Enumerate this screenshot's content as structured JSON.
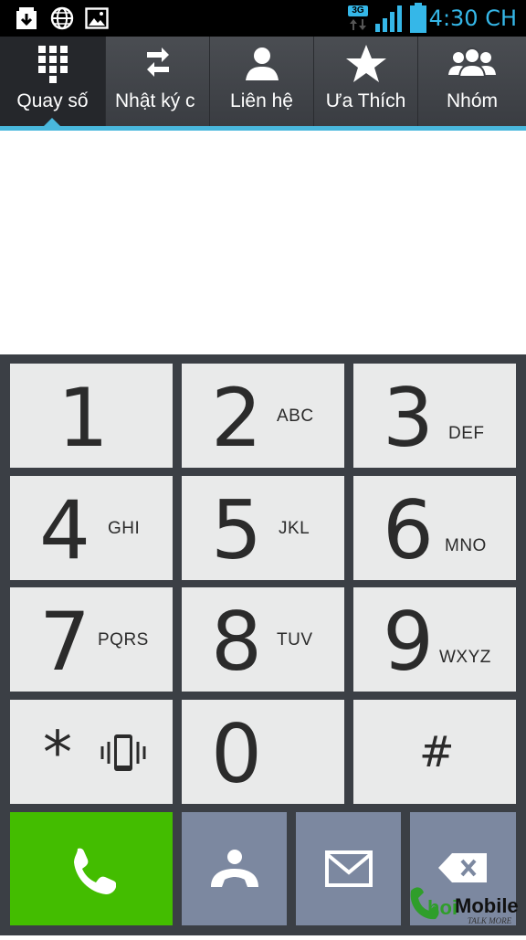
{
  "status_bar": {
    "time": "4:30 CH",
    "network_type": "3G",
    "icons": [
      "download-icon",
      "globe-icon",
      "image-icon",
      "signal-icon",
      "battery-icon"
    ]
  },
  "tabs": [
    {
      "label": "Quay số",
      "icon": "dialpad-icon",
      "active": true
    },
    {
      "label": "Nhật ký c",
      "icon": "call-log-icon",
      "active": false
    },
    {
      "label": "Liên hệ",
      "icon": "contact-icon",
      "active": false
    },
    {
      "label": "Ưa Thích",
      "icon": "star-icon",
      "active": false
    },
    {
      "label": "Nhóm",
      "icon": "group-icon",
      "active": false
    }
  ],
  "dial_input": {
    "value": ""
  },
  "keypad": [
    {
      "digit": "1",
      "letters": ""
    },
    {
      "digit": "2",
      "letters": "ABC"
    },
    {
      "digit": "3",
      "letters": "DEF"
    },
    {
      "digit": "4",
      "letters": "GHI"
    },
    {
      "digit": "5",
      "letters": "JKL"
    },
    {
      "digit": "6",
      "letters": "MNO"
    },
    {
      "digit": "7",
      "letters": "PQRS"
    },
    {
      "digit": "8",
      "letters": "TUV"
    },
    {
      "digit": "9",
      "letters": "WXYZ"
    },
    {
      "digit": "*",
      "letters": ""
    },
    {
      "digit": "0",
      "letters": ""
    },
    {
      "digit": "#",
      "letters": ""
    }
  ],
  "actions": [
    {
      "name": "call-button",
      "icon": "phone-icon"
    },
    {
      "name": "hangup-button",
      "icon": "hangup-icon"
    },
    {
      "name": "message-button",
      "icon": "envelope-icon"
    },
    {
      "name": "backspace-button",
      "icon": "backspace-icon"
    }
  ],
  "watermark": {
    "text": "Mobile",
    "tagline": "TALK MORE"
  },
  "colors": {
    "accent": "#49b8dd",
    "status_text": "#35b7e8",
    "call_green": "#43bd00",
    "action_grey": "#7c88a0",
    "key_bg": "#e9eaea",
    "keypad_bg": "#3b3f45"
  }
}
